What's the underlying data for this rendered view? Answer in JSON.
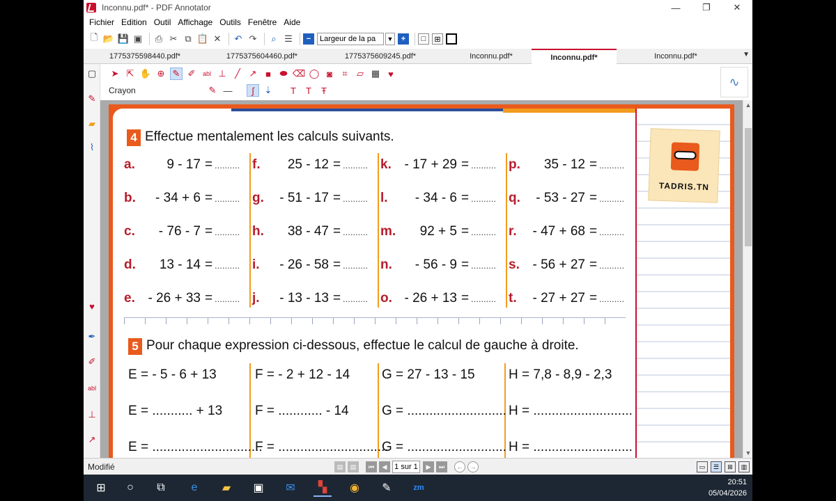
{
  "window": {
    "title": "Inconnu.pdf* - PDF Annotator",
    "minimize": "—",
    "restore": "❐",
    "close": "✕"
  },
  "menu": [
    "Fichier",
    "Edition",
    "Outil",
    "Affichage",
    "Outils",
    "Fenêtre",
    "Aide"
  ],
  "toolbar": {
    "zoom_value": "Largeur de la pa"
  },
  "tabs": [
    {
      "label": "1775375598440.pdf*",
      "active": false
    },
    {
      "label": "1775375604460.pdf*",
      "active": false
    },
    {
      "label": "1775375609245.pdf*",
      "active": false
    },
    {
      "label": "Inconnu.pdf*",
      "active": false
    },
    {
      "label": "Inconnu.pdf*",
      "active": true
    },
    {
      "label": "Inconnu.pdf*",
      "active": false
    }
  ],
  "annotation": {
    "tool_name": "Crayon"
  },
  "document": {
    "ex4": {
      "number": "4",
      "title": "Effectue mentalement les calculs suivants.",
      "columns": [
        [
          {
            "label": "a.",
            "expr": "9 - 17"
          },
          {
            "label": "b.",
            "expr": "- 34 + 6"
          },
          {
            "label": "c.",
            "expr": "- 76 - 7"
          },
          {
            "label": "d.",
            "expr": "13 - 14"
          },
          {
            "label": "e.",
            "expr": "- 26 + 33"
          }
        ],
        [
          {
            "label": "f.",
            "expr": "25 - 12"
          },
          {
            "label": "g.",
            "expr": "- 51 - 17"
          },
          {
            "label": "h.",
            "expr": "38 - 47"
          },
          {
            "label": "i.",
            "expr": "- 26 - 58"
          },
          {
            "label": "j.",
            "expr": "- 13 - 13"
          }
        ],
        [
          {
            "label": "k.",
            "expr": "- 17 + 29"
          },
          {
            "label": "l.",
            "expr": "- 34 - 6"
          },
          {
            "label": "m.",
            "expr": "92 + 5"
          },
          {
            "label": "n.",
            "expr": "- 56 - 9"
          },
          {
            "label": "o.",
            "expr": "- 26 + 13"
          }
        ],
        [
          {
            "label": "p.",
            "expr": "35 - 12"
          },
          {
            "label": "q.",
            "expr": "- 53 - 27"
          },
          {
            "label": "r.",
            "expr": "- 47 + 68"
          },
          {
            "label": "s.",
            "expr": "- 56 + 27"
          },
          {
            "label": "t.",
            "expr": "- 27 + 27"
          }
        ]
      ],
      "equals": "=",
      "dots": ".........."
    },
    "ex5": {
      "number": "5",
      "title": "Pour chaque expression ci-dessous, effectue le calcul de gauche à droite.",
      "rows": [
        [
          "E =  - 5 - 6 + 13",
          "F =  - 2 + 12 - 14",
          "G = 27 - 13  - 15",
          "H =  7,8 - 8,9 - 2,3"
        ],
        [
          "E =  ........... + 13",
          "F =   ............ - 14",
          "G = ...........................",
          "H = ..........................."
        ],
        [
          "E = ..............................",
          "F = ..............................",
          "G = ...........................",
          "H = ..........................."
        ]
      ]
    },
    "logo_text": "TADRIS.TN"
  },
  "status": {
    "text": "Modifié",
    "page_indicator": "1 sur 1"
  },
  "taskbar": {
    "time": "20:51",
    "date": "05/04/2026"
  }
}
